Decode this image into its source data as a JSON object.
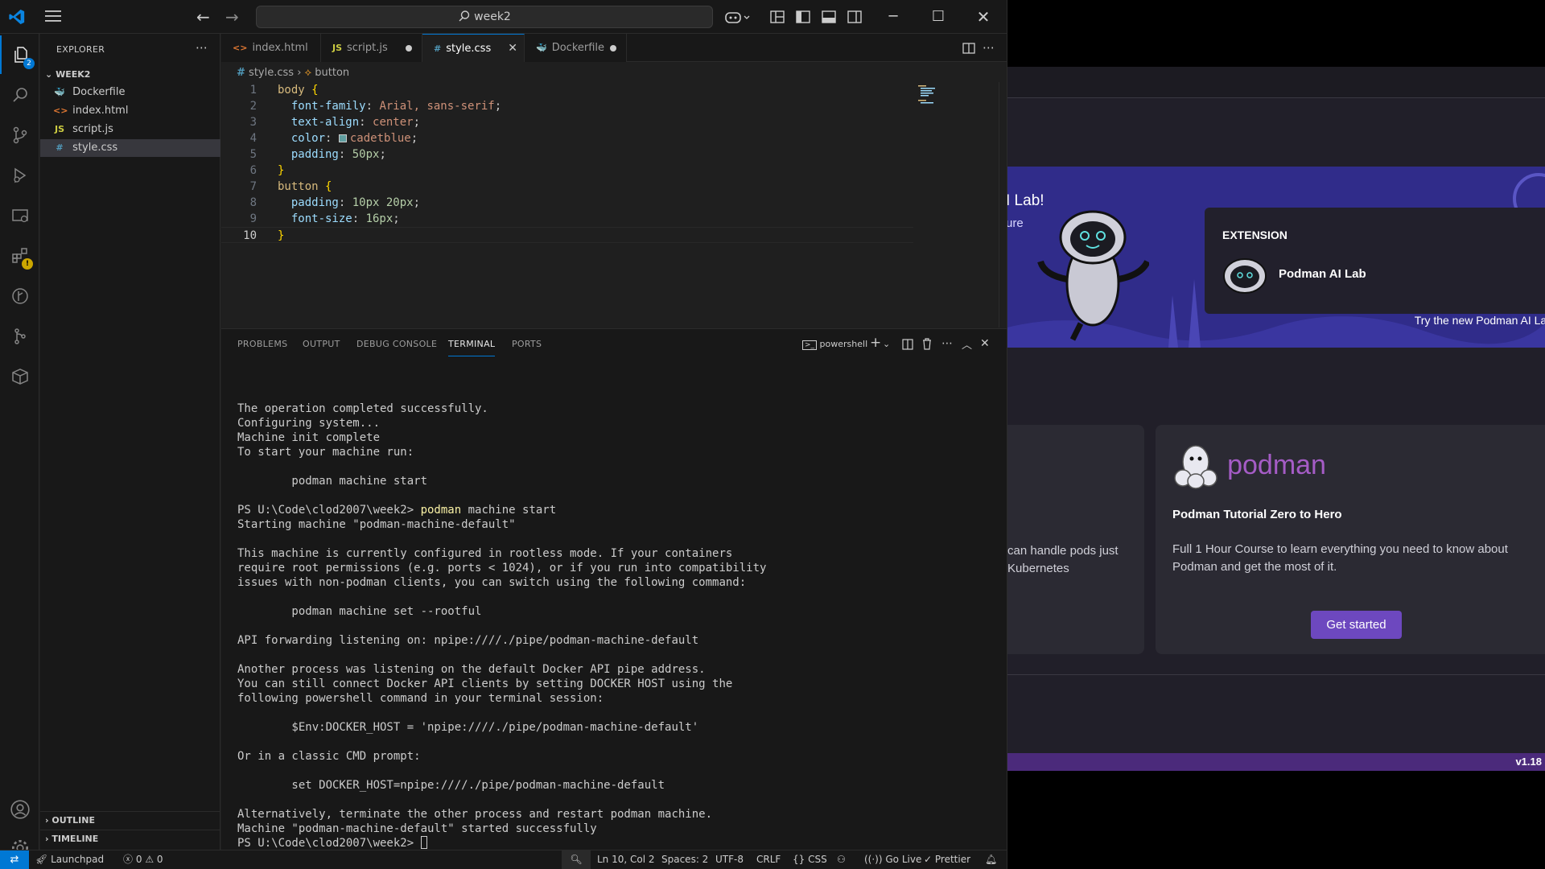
{
  "titlebar": {
    "search_text": "week2"
  },
  "activity": {
    "explorer_badge": "2",
    "extensions_warning": "!"
  },
  "sidebar": {
    "title": "EXPLORER",
    "folder": "WEEK2",
    "files": [
      {
        "name": "Dockerfile",
        "icon": "docker-icon",
        "glyph": "🐳",
        "color": "#4aa3df"
      },
      {
        "name": "index.html",
        "icon": "html-icon",
        "glyph": "<>",
        "color": "#e37933"
      },
      {
        "name": "script.js",
        "icon": "js-icon",
        "glyph": "JS",
        "color": "#cbcb41"
      },
      {
        "name": "style.css",
        "icon": "css-icon",
        "glyph": "#",
        "color": "#519aba"
      }
    ],
    "outline": "OUTLINE",
    "timeline": "TIMELINE"
  },
  "tabs": [
    {
      "name": "index.html",
      "glyph": "<>",
      "color": "#e37933",
      "state": "clean"
    },
    {
      "name": "script.js",
      "glyph": "JS",
      "color": "#cbcb41",
      "state": "dirty"
    },
    {
      "name": "style.css",
      "glyph": "#",
      "color": "#519aba",
      "state": "active"
    },
    {
      "name": "Dockerfile",
      "glyph": "🐳",
      "color": "#4aa3df",
      "state": "dirty"
    }
  ],
  "breadcrumb": {
    "file": "style.css",
    "symbol": "button"
  },
  "editor": {
    "lines": [
      {
        "n": "1",
        "html": "<span class='tok-sel'>body</span> <span class='tok-brace'>{</span>"
      },
      {
        "n": "2",
        "html": "  <span class='tok-prop'>font-family</span>: <span class='tok-val'>Arial, sans-serif</span>;"
      },
      {
        "n": "3",
        "html": "  <span class='tok-prop'>text-align</span>: <span class='tok-val'>center</span>;"
      },
      {
        "n": "4",
        "html": "  <span class='tok-prop'>color</span>: <span class='swatch'></span><span class='tok-val'>cadetblue</span>;"
      },
      {
        "n": "5",
        "html": "  <span class='tok-prop'>padding</span>: <span class='tok-num'>50px</span>;"
      },
      {
        "n": "6",
        "html": "<span class='tok-brace'>}</span>"
      },
      {
        "n": "7",
        "html": "<span class='tok-sel'>button</span> <span class='tok-brace'>{</span>"
      },
      {
        "n": "8",
        "html": "  <span class='tok-prop'>padding</span>: <span class='tok-num'>10px 20px</span>;"
      },
      {
        "n": "9",
        "html": "  <span class='tok-prop'>font-size</span>: <span class='tok-num'>16px</span>;"
      },
      {
        "n": "10",
        "html": "<span class='tok-brace'>}</span>"
      }
    ],
    "current_line": 10
  },
  "panel": {
    "tabs": [
      "PROBLEMS",
      "OUTPUT",
      "DEBUG CONSOLE",
      "TERMINAL",
      "PORTS"
    ],
    "active_tab": "TERMINAL",
    "shell": "powershell"
  },
  "terminal": {
    "lines": [
      "",
      "The operation completed successfully.",
      "Configuring system...",
      "Machine init complete",
      "To start your machine run:",
      "",
      "        podman machine start",
      "",
      {
        "prompt": "PS U:\\Code\\clod2007\\week2> ",
        "cmd": "podman",
        "rest": " machine start"
      },
      "Starting machine \"podman-machine-default\"",
      "",
      "This machine is currently configured in rootless mode. If your containers",
      "require root permissions (e.g. ports < 1024), or if you run into compatibility",
      "issues with non-podman clients, you can switch using the following command:",
      "",
      "        podman machine set --rootful",
      "",
      "API forwarding listening on: npipe:////./pipe/podman-machine-default",
      "",
      "Another process was listening on the default Docker API pipe address.",
      "You can still connect Docker API clients by setting DOCKER HOST using the",
      "following powershell command in your terminal session:",
      "",
      "        $Env:DOCKER_HOST = 'npipe:////./pipe/podman-machine-default'",
      "",
      "Or in a classic CMD prompt:",
      "",
      "        set DOCKER_HOST=npipe:////./pipe/podman-machine-default",
      "",
      "Alternatively, terminate the other process and restart podman machine.",
      "Machine \"podman-machine-default\" started successfully",
      {
        "prompt": "PS U:\\Code\\clod2007\\week2> ",
        "cursor": true
      }
    ]
  },
  "statusbar": {
    "launchpad": "Launchpad",
    "errors": "0",
    "warnings": "0",
    "position": "Ln 10, Col 2",
    "spaces": "Spaces: 2",
    "encoding": "UTF-8",
    "eol": "CRLF",
    "language": "CSS",
    "golive": "Go Live",
    "prettier": "Prettier"
  },
  "podman": {
    "hero_title": "I Lab!",
    "hero_sub": "ure",
    "extension_label": "EXTENSION",
    "extension_name": "Podman AI Lab",
    "hero_try": "Try the new Podman AI Lab",
    "card1_text_1": "can handle pods just",
    "card1_text_2": " Kubernetes",
    "brand": "podman",
    "card2_title": "Podman Tutorial Zero to Hero",
    "card2_desc": "Full 1 Hour Course to learn everything you need to know about Podman and get the most of it.",
    "get_started": "Get started",
    "version": "v1.18"
  },
  "colors": {
    "accent": "#0078d4",
    "podman_purple": "#6d48bf",
    "hero_blue": "#302c8a"
  }
}
